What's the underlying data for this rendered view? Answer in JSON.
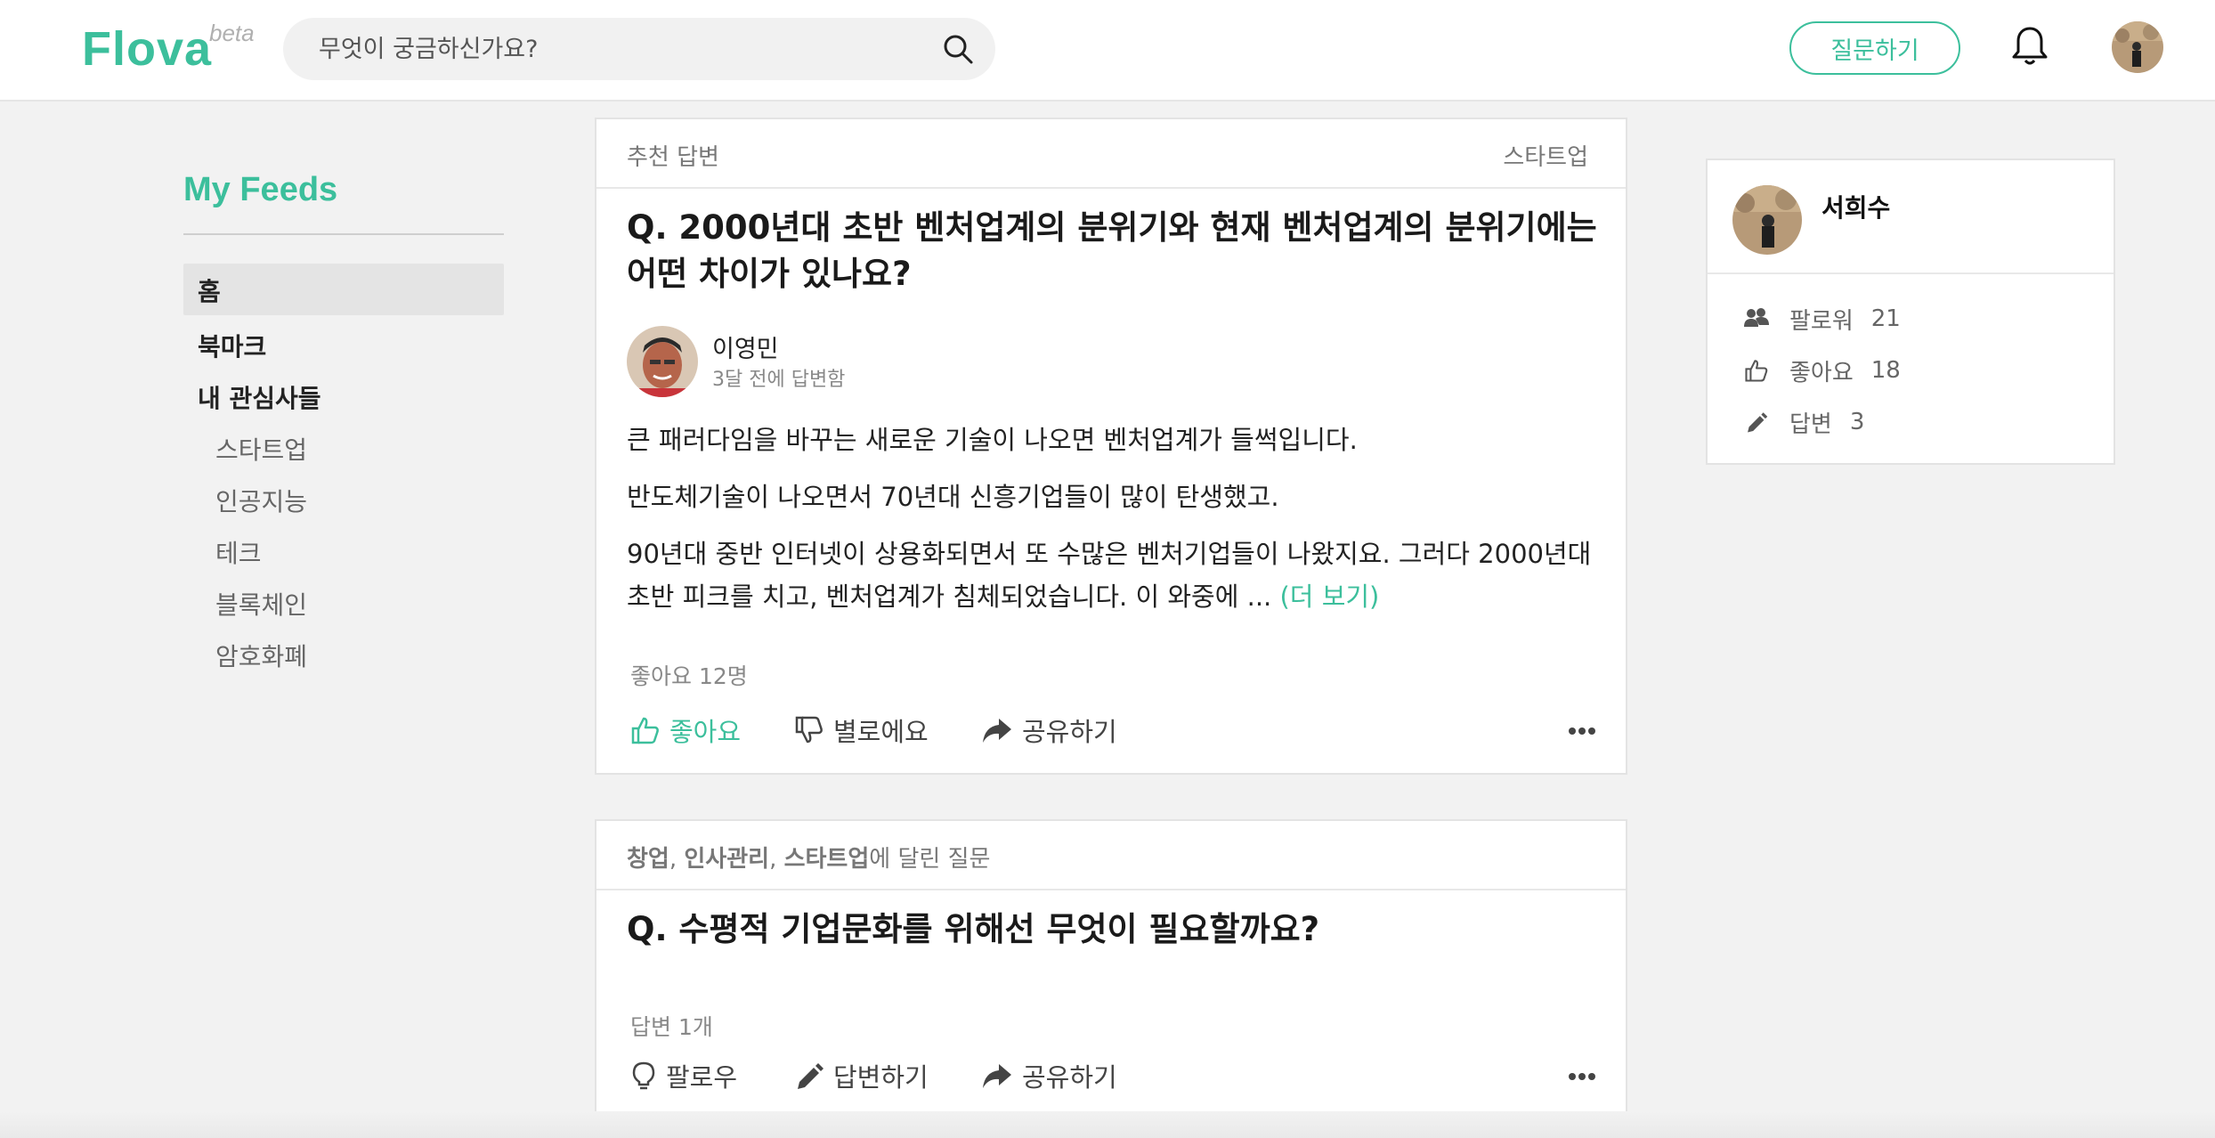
{
  "header": {
    "logo": "Flova",
    "logo_badge": "beta",
    "search_placeholder": "무엇이 궁금하신가요?",
    "ask_button": "질문하기"
  },
  "sidebar": {
    "title": "My Feeds",
    "items": [
      {
        "label": "홈",
        "selected": true
      },
      {
        "label": "북마크"
      },
      {
        "label": "내 관심사들"
      }
    ],
    "interests": [
      "스타트업",
      "인공지능",
      "테크",
      "블록체인",
      "암호화폐"
    ]
  },
  "feed": [
    {
      "tag": "추천 답변",
      "topic": "스타트업",
      "question_line1": "Q. 2000년대 초반 벤처업계의 분위기와 현재 벤처업계의 분위기에는",
      "question_line2": "어떤 차이가 있나요?",
      "author": "이영민",
      "answered": "3달 전에 답변함",
      "paragraphs": [
        "큰 패러다임을 바꾸는 새로운 기술이 나오면 벤처업계가 들썩입니다.",
        "반도체기술이 나오면서 70년대 신흥기업들이 많이 탄생했고.",
        "90년대 중반 인터넷이 상용화되면서 또 수많은 벤처기업들이 나왔지요. 그러다 2000년대 초반 피크를 치고, 벤처업계가 침체되었습니다. 이 와중에 ... "
      ],
      "more_link": "(더 보기)",
      "like_count": "좋아요 12명",
      "actions": {
        "like": "좋아요",
        "dislike": "별로에요",
        "share": "공유하기"
      }
    },
    {
      "tag_topics": [
        "창업",
        "인사관리",
        "스타트업"
      ],
      "tag_suffix": "에 달린 질문",
      "question": "Q. 수평적 기업문화를 위해선 무엇이 필요할까요?",
      "answer_count": "답변 1개",
      "actions": {
        "follow": "팔로우",
        "answer": "답변하기",
        "share": "공유하기"
      }
    }
  ],
  "profile": {
    "name": "서희수",
    "stats": [
      {
        "label": "팔로워",
        "value": "21",
        "icon": "users-icon"
      },
      {
        "label": "좋아요",
        "value": "18",
        "icon": "thumbs-up-icon"
      },
      {
        "label": "답변",
        "value": "3",
        "icon": "pencil-icon"
      }
    ]
  },
  "colors": {
    "accent": "#3cbf9c",
    "background": "#f2f2f2"
  }
}
